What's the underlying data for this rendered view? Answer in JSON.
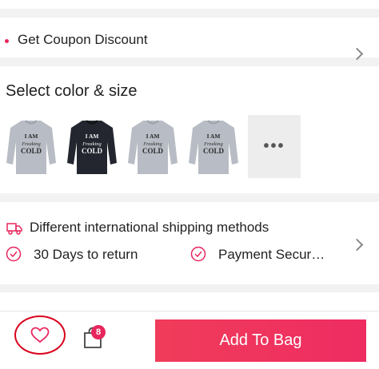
{
  "coupon": {
    "label": "Get Coupon Discount"
  },
  "color_section": {
    "title": "Select color & size",
    "swatches": [
      {
        "color": "gray",
        "print": [
          "I AM",
          "Freaking",
          "COLD"
        ]
      },
      {
        "color": "black",
        "print": [
          "I AM",
          "Freaking",
          "COLD"
        ]
      },
      {
        "color": "gray",
        "print": [
          "I AM",
          "Freaking",
          "COLD"
        ]
      },
      {
        "color": "gray",
        "print": [
          "I AM",
          "Freaking",
          "COLD"
        ]
      }
    ],
    "more_label": "•••"
  },
  "shipping": {
    "methods_label": "Different international shipping methods",
    "return_label": "30 Days to return",
    "payment_label": "Payment Secur…"
  },
  "bottom_bar": {
    "bag_count": "8",
    "add_to_bag_label": "Add To Bag"
  },
  "colors": {
    "accent": "#e8265e",
    "button": "#f03c5a",
    "sweater_gray": "#b8bcc4",
    "sweater_black": "#23262e"
  }
}
